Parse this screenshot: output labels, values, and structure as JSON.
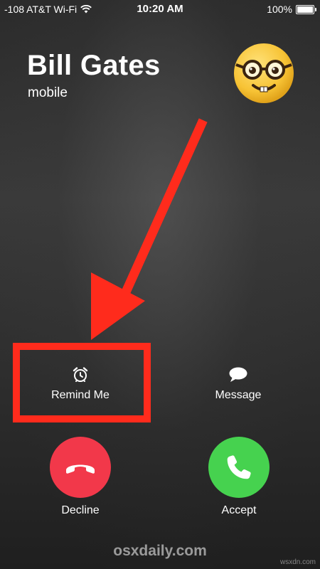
{
  "status_bar": {
    "signal": "-108 AT&T Wi-Fi",
    "time": "10:20 AM",
    "battery": "100%"
  },
  "caller": {
    "name": "Bill Gates",
    "label": "mobile",
    "avatar_icon": "nerd-face-emoji-icon"
  },
  "actions": {
    "remind_me": "Remind Me",
    "message": "Message",
    "decline": "Decline",
    "accept": "Accept"
  },
  "annotation": {
    "color": "#ff2b1c",
    "highlight": "remind-me"
  },
  "watermark": "osxdaily.com",
  "corner_mark": "wsxdn.com",
  "colors": {
    "decline": "#f2384a",
    "accept": "#46d24f"
  }
}
